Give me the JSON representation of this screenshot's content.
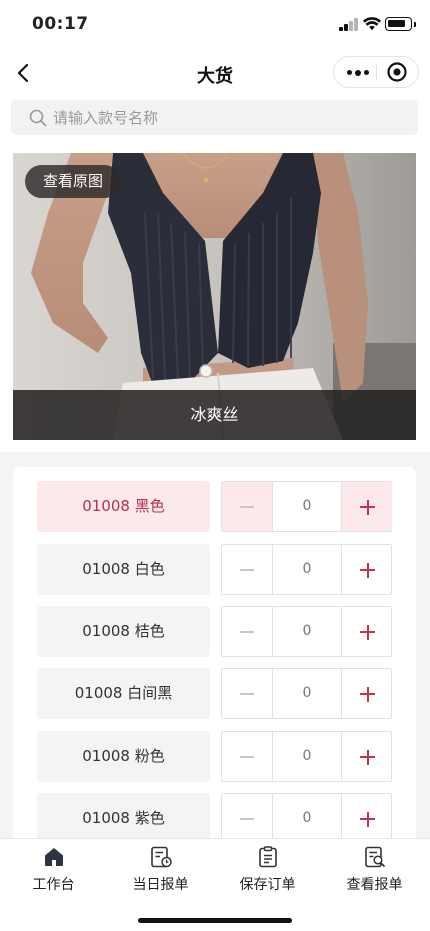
{
  "status_bar": {
    "time": "00:17"
  },
  "nav": {
    "title": "大货"
  },
  "search": {
    "placeholder": "请输入款号名称"
  },
  "product": {
    "view_original_label": "查看原图",
    "caption": "冰爽丝"
  },
  "variants": [
    {
      "label": "01008 黑色",
      "qty": "0",
      "selected": true
    },
    {
      "label": "01008 白色",
      "qty": "0",
      "selected": false
    },
    {
      "label": "01008 桔色",
      "qty": "0",
      "selected": false
    },
    {
      "label": "01008 白间黑",
      "qty": "0",
      "selected": false
    },
    {
      "label": "01008 粉色",
      "qty": "0",
      "selected": false
    },
    {
      "label": "01008 紫色",
      "qty": "0",
      "selected": false
    }
  ],
  "tab_bar": {
    "items": [
      {
        "label": "工作台",
        "icon": "home-icon"
      },
      {
        "label": "当日报单",
        "icon": "daily-report-icon"
      },
      {
        "label": "保存订单",
        "icon": "clipboard-icon"
      },
      {
        "label": "查看报单",
        "icon": "search-report-icon"
      }
    ]
  },
  "colors": {
    "accent": "#c8324f",
    "selected_bg": "#fbe9ec",
    "selected_text": "#b3324d"
  }
}
